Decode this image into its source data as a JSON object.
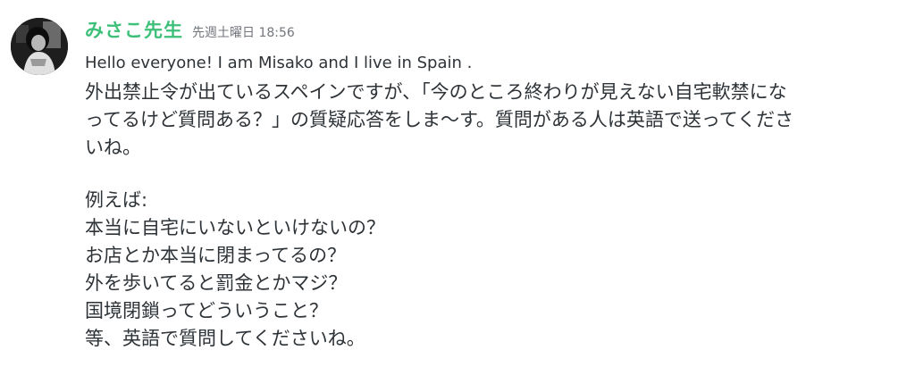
{
  "message": {
    "username": "みさこ先生",
    "timestamp": "先週土曜日 18:56",
    "lines": [
      "Hello everyone! I am Misako and I live in Spain .",
      "外出禁止令が出ているスペインですが、「今のところ終わりが見えない自宅軟禁にな",
      "ってるけど質問ある？」の質疑応答をしま〜す。質問がある人は英語で送ってくださ",
      "いね。",
      "",
      "例えば:",
      "本当に自宅にいないといけないの？",
      "お店とか本当に閉まってるの？",
      "外を歩いてると罰金とかマジ？",
      "国境閉鎖ってどういうこと？",
      "等、英語で質問してくださいね。"
    ]
  },
  "colors": {
    "username": "#3ec07a",
    "timestamp": "#72767d",
    "text": "#2e3338",
    "background": "#ffffff"
  },
  "icons": {
    "avatar": "user-avatar"
  }
}
